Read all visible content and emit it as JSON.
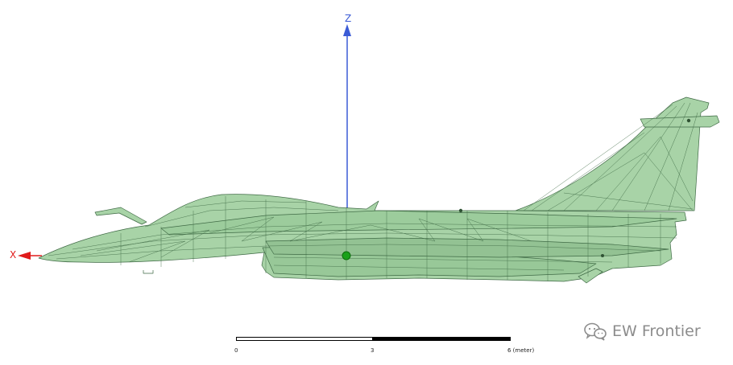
{
  "axes": {
    "z_label": "Z",
    "x_label": "X",
    "z_color": "#3b5bd6",
    "x_color": "#e01b1b"
  },
  "model": {
    "fill_color": "#a8d3a7",
    "mesh_color": "#3f6a45",
    "marker_color": "#1aa11a"
  },
  "scale_bar": {
    "tick_0": "0",
    "tick_3": "3",
    "tick_6": "6 (meter)"
  },
  "watermark": {
    "icon": "wechat-icon",
    "text": "EW Frontier"
  }
}
